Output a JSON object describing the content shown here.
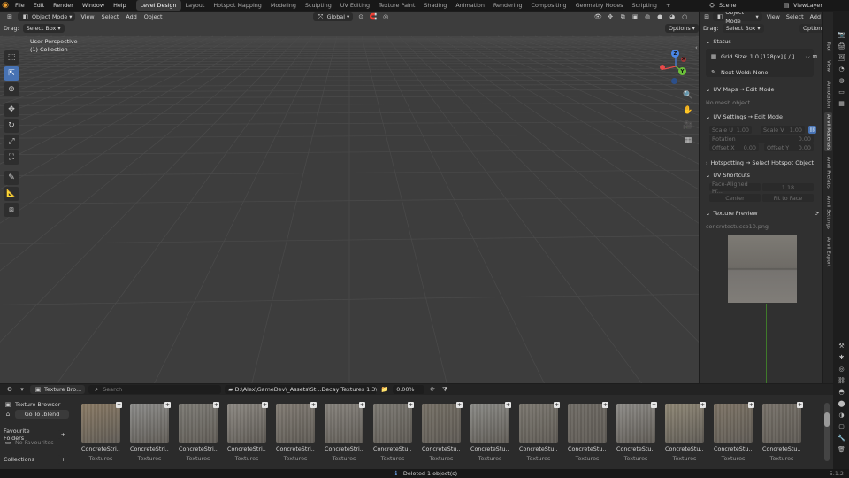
{
  "topbar": {
    "menus": [
      "File",
      "Edit",
      "Render",
      "Window",
      "Help"
    ],
    "workspaces": [
      "Level Design",
      "Layout",
      "Hotspot Mapping",
      "Modeling",
      "Sculpting",
      "UV Editing",
      "Texture Paint",
      "Shading",
      "Animation",
      "Rendering",
      "Compositing",
      "Geometry Nodes",
      "Scripting"
    ],
    "active_workspace": "Level Design",
    "add_tab": "+",
    "scene": "Scene",
    "view_layer": "ViewLayer"
  },
  "viewport": {
    "mode": "Object Mode",
    "menus": [
      "View",
      "Select",
      "Add",
      "Object"
    ],
    "orientation": "Global",
    "drag_label": "Drag:",
    "drag_value": "Select Box",
    "options": "Options",
    "overlay_line1": "User Perspective",
    "overlay_line2": "(1) Collection",
    "gizmo": {
      "x": "X",
      "y": "Y",
      "z": "Z"
    }
  },
  "rightpanel": {
    "mode": "Object Mode",
    "menus": [
      "View",
      "Select",
      "Add"
    ],
    "drag_label": "Drag:",
    "drag_value": "Select Box",
    "options": "Options",
    "status_title": "Status",
    "grid_size": "Grid Size: 1.0  [128px]  [ / ]",
    "next_weld": "Next Weld: None",
    "uv_maps_title": "UV Maps  → Edit Mode",
    "no_mesh": "No mesh object",
    "uv_settings_title": "UV Settings  → Edit Mode",
    "scale_u_label": "Scale U",
    "scale_u": "1.00",
    "scale_v_label": "Scale V",
    "scale_v": "1.00",
    "rotation_label": "Rotation",
    "rotation": "0.00",
    "offset_x_label": "Offset X",
    "offset_x": "0.00",
    "offset_y_label": "Offset Y",
    "offset_y": "0.00",
    "hotspotting_title": "Hotspotting  → Select Hotspot Object",
    "uv_shortcuts_title": "UV Shortcuts",
    "face_aligned": "Face-Aligned Pr...",
    "face_aligned_val": "1.18",
    "center": "Center",
    "fit_to_face": "Fit to Face",
    "texture_preview_title": "Texture Preview",
    "texture_file": "concretestucco10.png"
  },
  "tabs": [
    "Tool",
    "View",
    "Annotation",
    "Anvil Materials",
    "Anvil Prefabs",
    "Anvil Settings",
    "Anvil Export"
  ],
  "active_tab": "Anvil Materials",
  "browser": {
    "editor_label": "Texture Bro...",
    "search_placeholder": "Search",
    "path": "D:\\Alex\\GameDev\\_Assets\\St...Decay Textures 1.3\\Textures",
    "zoom": "0.00%",
    "sidebar_title": "Texture Browser",
    "go_to_blend": "Go To .blend",
    "favourite_folders": "Favourite Folders",
    "no_favourites": "No Favourites",
    "collections": "Collections",
    "thumbnails": [
      {
        "name": "ConcreteStri...",
        "cat": "Textures",
        "color": "#8a7a64"
      },
      {
        "name": "ConcreteStri...",
        "cat": "Textures",
        "color": "#8c8c8a"
      },
      {
        "name": "ConcreteStri...",
        "cat": "Textures",
        "color": "#7c7a74"
      },
      {
        "name": "ConcreteStri...",
        "cat": "Textures",
        "color": "#8a8680"
      },
      {
        "name": "ConcreteStri...",
        "cat": "Textures",
        "color": "#807a72"
      },
      {
        "name": "ConcreteStri...",
        "cat": "Textures",
        "color": "#86827c"
      },
      {
        "name": "ConcreteStu...",
        "cat": "Textures",
        "color": "#7a7770"
      },
      {
        "name": "ConcreteStu...",
        "cat": "Textures",
        "color": "#746e64"
      },
      {
        "name": "ConcreteStu...",
        "cat": "Textures",
        "color": "#8a8a86"
      },
      {
        "name": "ConcreteStu...",
        "cat": "Textures",
        "color": "#7a766e"
      },
      {
        "name": "ConcreteStu...",
        "cat": "Textures",
        "color": "#6e6a64"
      },
      {
        "name": "ConcreteStu...",
        "cat": "Textures",
        "color": "#8c8a86"
      },
      {
        "name": "ConcreteStu...",
        "cat": "Textures",
        "color": "#8e8674"
      },
      {
        "name": "ConcreteStu...",
        "cat": "Textures",
        "color": "#7c7264"
      },
      {
        "name": "ConcreteStu...",
        "cat": "Textures",
        "color": "#767068"
      }
    ]
  },
  "status": {
    "message": "Deleted 1 object(s)",
    "version": "5.1.2"
  }
}
